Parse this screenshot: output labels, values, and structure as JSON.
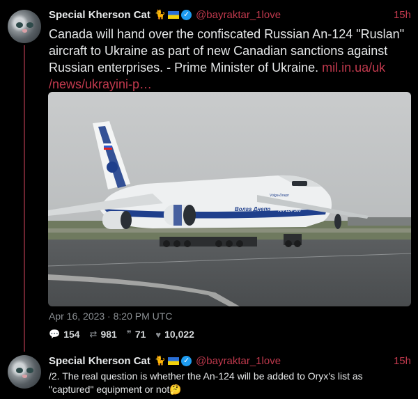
{
  "tweet1": {
    "author_name": "Special Kherson Cat",
    "handle": "@bayraktar_1love",
    "time": "15h",
    "text": "Canada will hand over the confiscated Russian An-124 \"Ruslan\" aircraft to Ukraine as part of new Canadian sanctions against Russian enterprises. - Prime Minister of Ukraine.",
    "link": "mil.in.ua/uk /news/ukrayini-p…",
    "image": {
      "tail_text": "",
      "fuselage_brand": "Волга Днепр",
      "nose_brand": "Volga-Dnepr",
      "model_label": "AN-124-100"
    },
    "date": "Apr 16, 2023 · 8:20 PM UTC",
    "stats": {
      "replies": "154",
      "retweets": "981",
      "quotes": "71",
      "likes": "10,022"
    }
  },
  "tweet2": {
    "author_name": "Special Kherson Cat",
    "handle": "@bayraktar_1love",
    "time": "15h",
    "text": "/2. The real question is whether the An-124 will be added to Oryx's list as \"captured\" equipment or not🤔"
  },
  "colors": {
    "background": "#000000",
    "accent": "#c0394d",
    "thread_line": "#6d2430",
    "muted": "#8b8f93",
    "verified": "#1d9bf0"
  },
  "icons": {
    "reply": "comment-icon",
    "retweet": "retweet-icon",
    "quote": "quote-icon",
    "like": "heart-icon"
  }
}
